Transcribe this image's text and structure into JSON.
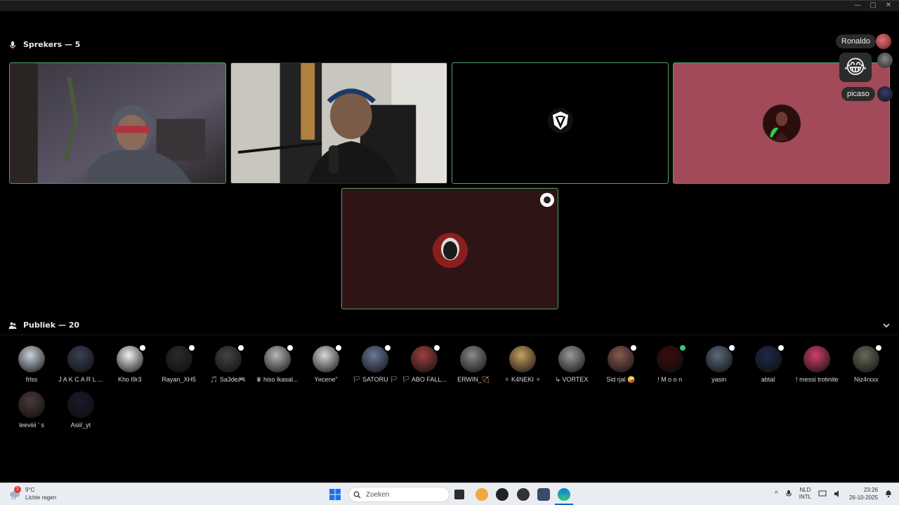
{
  "window": {
    "controls": [
      "—",
      "▢",
      "✕"
    ]
  },
  "speakers": {
    "label": "Sprekers — 5"
  },
  "audience": {
    "label": "Publiek — 20"
  },
  "side_panel": {
    "names": [
      "Ronaldo",
      "picaso"
    ],
    "emoji": "😂"
  },
  "audience_members": [
    {
      "name": "frlss",
      "badge": "none"
    },
    {
      "name": "J A K C A R L ...",
      "badge": "none"
    },
    {
      "name": "Kho l9r3",
      "badge": "white"
    },
    {
      "name": "Rayan_XH5",
      "badge": "white"
    },
    {
      "name": "🎵 Sa3de🎮",
      "badge": "white"
    },
    {
      "name": "♛ hiso lkasal...",
      "badge": "white"
    },
    {
      "name": "Үнcene\"",
      "badge": "white"
    },
    {
      "name": "🏳 SATORU 🏳",
      "badge": "white"
    },
    {
      "name": "🏳 ABO FALL...",
      "badge": "white"
    },
    {
      "name": "ERWIN_🏹",
      "badge": "none"
    },
    {
      "name": "✧ K4NEKI ✧",
      "badge": "none"
    },
    {
      "name": "↳ VORTEX",
      "badge": "none"
    },
    {
      "name": "Sid rjal 🤪",
      "badge": "white"
    },
    {
      "name": "! M o o n",
      "badge": "green"
    },
    {
      "name": "yasin",
      "badge": "white"
    },
    {
      "name": "abtal",
      "badge": "white"
    },
    {
      "name": "! messi trotinite",
      "badge": "none"
    },
    {
      "name": "Niz4rxxx",
      "badge": "white"
    },
    {
      "name": "leeviiii ' s",
      "badge": "none"
    },
    {
      "name": "Asiil_yt",
      "badge": "none"
    }
  ],
  "taskbar": {
    "weather_temp": "9°C",
    "weather_desc": "Lichte regen",
    "weather_badge": "1",
    "search_placeholder": "Zoeken",
    "lang_top": "NLD",
    "lang_bottom": "INTL",
    "time": "23:26",
    "date": "26-10-2025"
  },
  "colors": {
    "tile_border": "#4fa36a",
    "tile4_bg": "#a24a57",
    "tile5_bg": "#2e1414"
  }
}
